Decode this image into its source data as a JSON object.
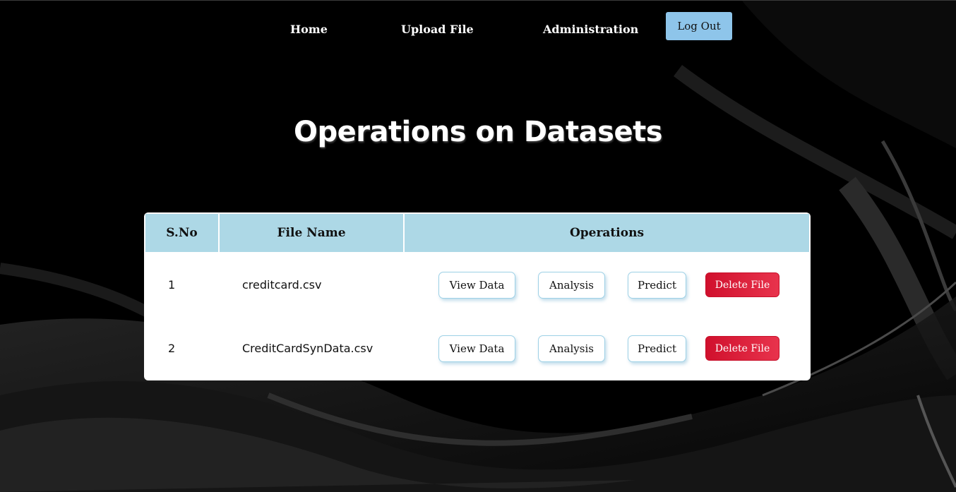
{
  "nav": {
    "home": "Home",
    "upload": "Upload File",
    "admin": "Administration",
    "logout": "Log Out"
  },
  "title": "Operations on Datasets",
  "table": {
    "headers": [
      "S.No",
      "File Name",
      "Operations"
    ],
    "rows": [
      {
        "sno": "1",
        "file": "creditcard.csv",
        "actions": [
          "View Data",
          "Analysis",
          "Predict",
          "Delete File"
        ]
      },
      {
        "sno": "2",
        "file": "CreditCardSynData.csv",
        "actions": [
          "View Data",
          "Analysis",
          "Predict",
          "Delete File"
        ]
      }
    ]
  },
  "colors": {
    "header_bg": "#add8e6",
    "logout_bg": "#8ec5ea",
    "delete_bg": "#dc143c"
  }
}
